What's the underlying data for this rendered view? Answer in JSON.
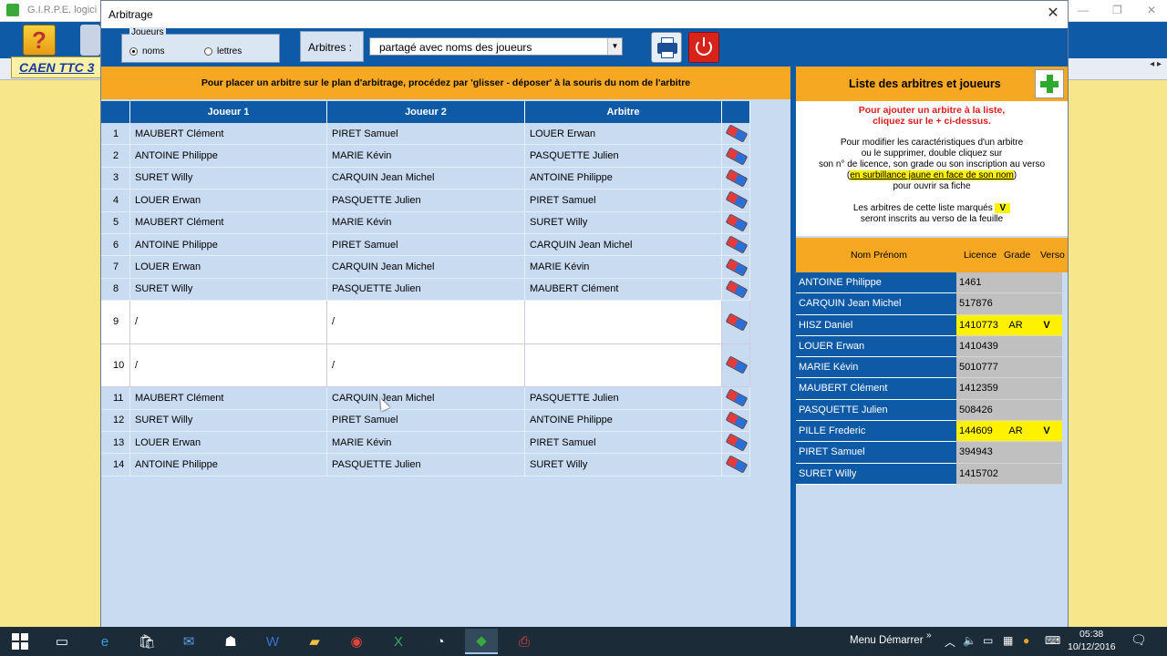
{
  "background_app": {
    "title": "G.I.R.P.E.  logici",
    "tab": "CAEN TTC 3",
    "nav": "◂ ▸",
    "help_icon": "question-icon"
  },
  "dialog": {
    "title": "Arbitrage",
    "close_glyph": "✕",
    "joueurs_legend": "Joueurs",
    "radio_noms": "noms",
    "radio_lettres": "lettres",
    "radio_selected": "noms",
    "arbitres_label": "Arbitres :",
    "arbitres_select_value": "partagé avec noms des joueurs",
    "instruction": "Pour placer un arbitre sur le plan d'arbitrage, procédez par 'glisser - déposer'  à la souris du nom de l'arbitre",
    "columns": [
      "",
      "Joueur 1",
      "Joueur 2",
      "Arbitre",
      ""
    ],
    "rows": [
      {
        "num": "1",
        "j1": "MAUBERT Clément",
        "j2": "PIRET Samuel",
        "arb": "LOUER Erwan"
      },
      {
        "num": "2",
        "j1": "ANTOINE Philippe",
        "j2": "MARIE Kévin",
        "arb": "PASQUETTE Julien"
      },
      {
        "num": "3",
        "j1": "SURET Willy",
        "j2": "CARQUIN Jean Michel",
        "arb": "ANTOINE Philippe"
      },
      {
        "num": "4",
        "j1": "LOUER Erwan",
        "j2": "PASQUETTE Julien",
        "arb": "PIRET Samuel"
      },
      {
        "num": "5",
        "j1": "MAUBERT Clément",
        "j2": "MARIE Kévin",
        "arb": "SURET Willy"
      },
      {
        "num": "6",
        "j1": "ANTOINE Philippe",
        "j2": "PIRET Samuel",
        "arb": "CARQUIN Jean Michel"
      },
      {
        "num": "7",
        "j1": "LOUER Erwan",
        "j2": "CARQUIN Jean Michel",
        "arb": "MARIE Kévin"
      },
      {
        "num": "8",
        "j1": "SURET Willy",
        "j2": "PASQUETTE Julien",
        "arb": "MAUBERT Clément"
      },
      {
        "num": "9",
        "j1": "/",
        "j2": "/",
        "arb": ""
      },
      {
        "num": "10",
        "j1": "/",
        "j2": "/",
        "arb": ""
      },
      {
        "num": "11",
        "j1": "MAUBERT Clément",
        "j2": "CARQUIN Jean Michel",
        "arb": "PASQUETTE Julien"
      },
      {
        "num": "12",
        "j1": "SURET Willy",
        "j2": "PIRET Samuel",
        "arb": "ANTOINE Philippe"
      },
      {
        "num": "13",
        "j1": "LOUER Erwan",
        "j2": "MARIE Kévin",
        "arb": "PIRET Samuel"
      },
      {
        "num": "14",
        "j1": "ANTOINE Philippe",
        "j2": "PASQUETTE Julien",
        "arb": "SURET Willy"
      }
    ],
    "right_panel": {
      "title": "Liste des arbitres et joueurs",
      "red_line1": "Pour ajouter un arbitre à la liste,",
      "red_line2": "cliquez sur le + ci-dessus.",
      "info1": "Pour modifier les caractéristiques d'un arbitre",
      "info2": "ou le supprimer, double cliquez sur",
      "info3": "son n° de licence, son grade ou son inscription au verso",
      "info4_pre": "(",
      "info4_hl": "en surbillance jaune en face de son nom",
      "info4_post": ")",
      "info5": "pour ouvrir sa fiche",
      "info6_pre": "Les arbitres de cette liste marqués",
      "info6_mark": "V",
      "info7": "seront inscrits au verso de la feuille",
      "col_name": "Nom Prénom",
      "col_licence": "Licence",
      "col_grade": "Grade",
      "col_verso": "Verso",
      "people": [
        {
          "name": "ANTOINE  Philippe",
          "licence": "1461",
          "grade": "",
          "verso": "",
          "inscrit": false
        },
        {
          "name": "CARQUIN  Jean Michel",
          "licence": "517876",
          "grade": "",
          "verso": "",
          "inscrit": false
        },
        {
          "name": "HISZ  Daniel",
          "licence": "1410773",
          "grade": "AR",
          "verso": "V",
          "inscrit": true
        },
        {
          "name": "LOUER  Erwan",
          "licence": "1410439",
          "grade": "",
          "verso": "",
          "inscrit": false
        },
        {
          "name": "MARIE  Kévin",
          "licence": "5010777",
          "grade": "",
          "verso": "",
          "inscrit": false
        },
        {
          "name": "MAUBERT  Clément",
          "licence": "1412359",
          "grade": "",
          "verso": "",
          "inscrit": false
        },
        {
          "name": "PASQUETTE  Julien",
          "licence": "508426",
          "grade": "",
          "verso": "",
          "inscrit": false
        },
        {
          "name": "PILLE  Frederic",
          "licence": "144609",
          "grade": "AR",
          "verso": "V",
          "inscrit": true
        },
        {
          "name": "PIRET  Samuel",
          "licence": "394943",
          "grade": "",
          "verso": "",
          "inscrit": false
        },
        {
          "name": "SURET  Willy",
          "licence": "1415702",
          "grade": "",
          "verso": "",
          "inscrit": false
        }
      ]
    }
  },
  "taskbar": {
    "menu_label": "Menu Démarrer",
    "chevron": "»",
    "time": "05:38",
    "date": "10/12/2016"
  }
}
